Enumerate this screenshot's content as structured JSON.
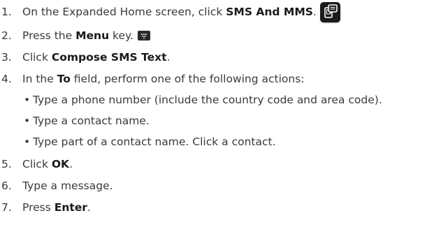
{
  "steps": [
    {
      "num": "1.",
      "pre": "On the Expanded Home screen, click ",
      "bold": "SMS And MMS",
      "post": ".",
      "icon": "sms-mms-icon"
    },
    {
      "num": "2.",
      "pre": "Press the ",
      "bold": "Menu",
      "post": " key.",
      "icon": "menu-key-icon"
    },
    {
      "num": "3.",
      "pre": "Click ",
      "bold": "Compose SMS Text",
      "post": "."
    },
    {
      "num": "4.",
      "pre": "In the ",
      "bold": "To",
      "post": " field, perform one of the following actions:"
    },
    {
      "num": "5.",
      "pre": "Click ",
      "bold": "OK",
      "post": "."
    },
    {
      "num": "6.",
      "pre": "Type a message.",
      "bold": "",
      "post": ""
    },
    {
      "num": "7.",
      "pre": "Press ",
      "bold": "Enter",
      "post": "."
    }
  ],
  "sub_actions": [
    {
      "bullet": "•",
      "text": "Type a phone number (include the country code and area code)."
    },
    {
      "bullet": "•",
      "text": "Type a contact name."
    },
    {
      "bullet": "•",
      "text": "Type part of a contact name. Click a contact."
    }
  ]
}
